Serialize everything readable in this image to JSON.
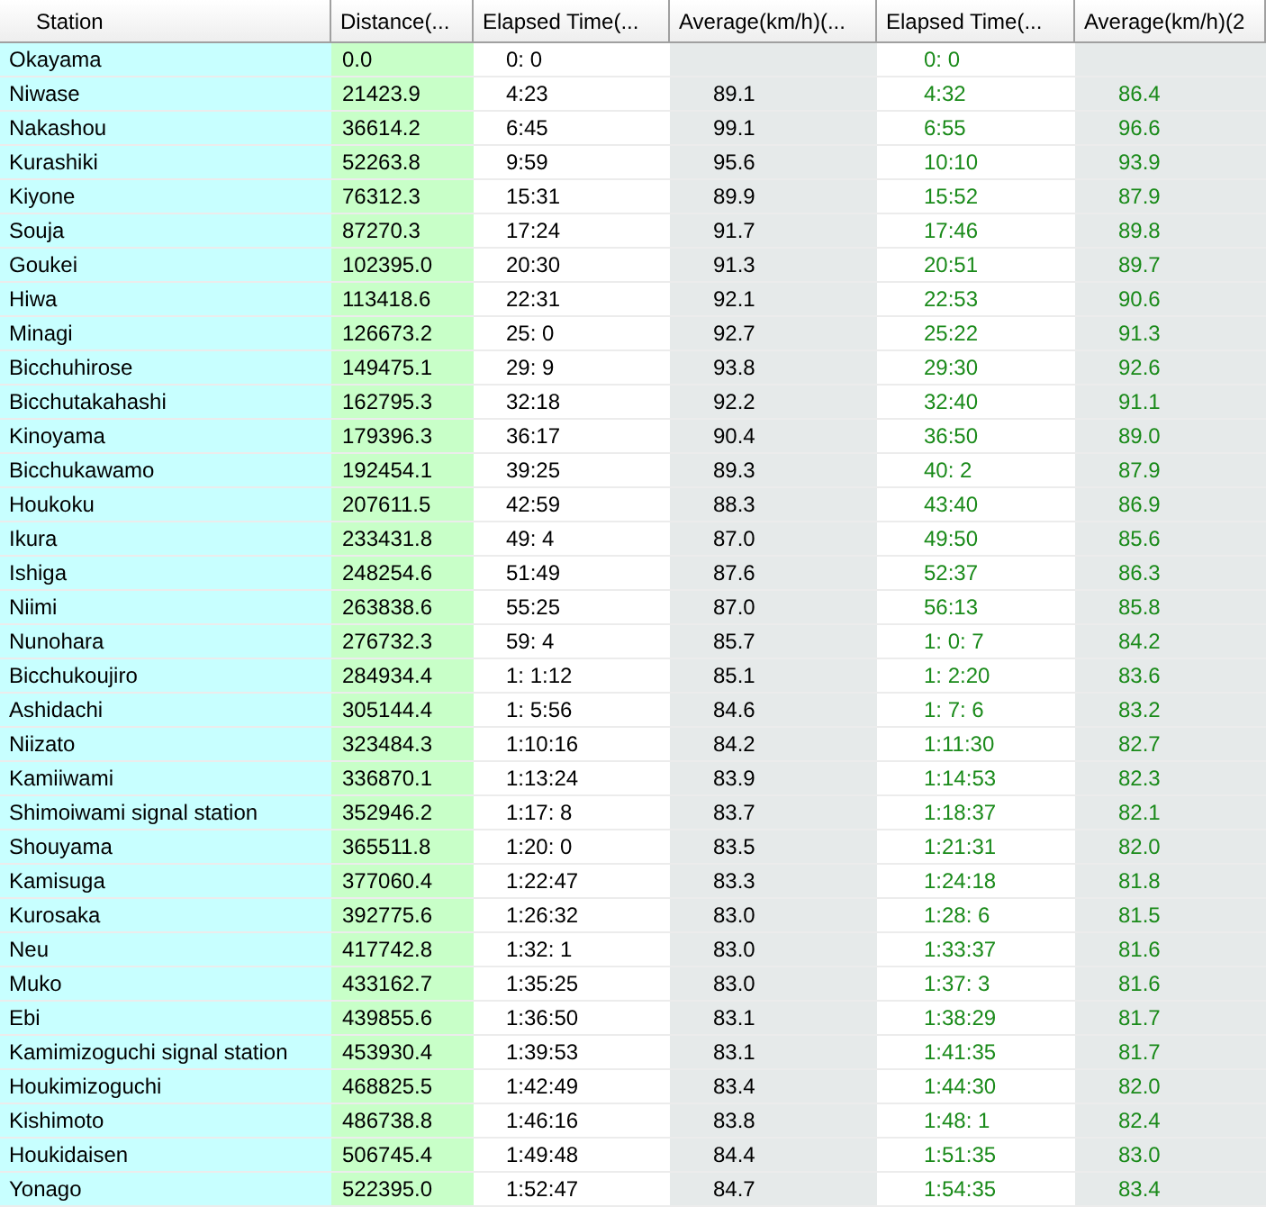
{
  "table": {
    "columns": [
      "Station",
      "Distance(...",
      "Elapsed Time(...",
      "Average(km/h)(...",
      "Elapsed Time(...",
      "Average(km/h)(2"
    ],
    "rows": [
      {
        "station": "Okayama",
        "distance": "0.0",
        "elapsed_1": "0: 0",
        "elapsed_2": "0: 0"
      },
      {
        "station": "Niwase",
        "distance": "21423.9",
        "elapsed_1": "4:23",
        "average_1": "89.1",
        "elapsed_2": "4:32",
        "average_2": "86.4"
      },
      {
        "station": "Nakashou",
        "distance": "36614.2",
        "elapsed_1": "6:45",
        "average_1": "99.1",
        "elapsed_2": "6:55",
        "average_2": "96.6"
      },
      {
        "station": "Kurashiki",
        "distance": "52263.8",
        "elapsed_1": "9:59",
        "average_1": "95.6",
        "elapsed_2": "10:10",
        "average_2": "93.9"
      },
      {
        "station": "Kiyone",
        "distance": "76312.3",
        "elapsed_1": "15:31",
        "average_1": "89.9",
        "elapsed_2": "15:52",
        "average_2": "87.9"
      },
      {
        "station": "Souja",
        "distance": "87270.3",
        "elapsed_1": "17:24",
        "average_1": "91.7",
        "elapsed_2": "17:46",
        "average_2": "89.8"
      },
      {
        "station": "Goukei",
        "distance": "102395.0",
        "elapsed_1": "20:30",
        "average_1": "91.3",
        "elapsed_2": "20:51",
        "average_2": "89.7"
      },
      {
        "station": "Hiwa",
        "distance": "113418.6",
        "elapsed_1": "22:31",
        "average_1": "92.1",
        "elapsed_2": "22:53",
        "average_2": "90.6"
      },
      {
        "station": "Minagi",
        "distance": "126673.2",
        "elapsed_1": "25: 0",
        "average_1": "92.7",
        "elapsed_2": "25:22",
        "average_2": "91.3"
      },
      {
        "station": "Bicchuhirose",
        "distance": "149475.1",
        "elapsed_1": "29: 9",
        "average_1": "93.8",
        "elapsed_2": "29:30",
        "average_2": "92.6"
      },
      {
        "station": "Bicchutakahashi",
        "distance": "162795.3",
        "elapsed_1": "32:18",
        "average_1": "92.2",
        "elapsed_2": "32:40",
        "average_2": "91.1"
      },
      {
        "station": "Kinoyama",
        "distance": "179396.3",
        "elapsed_1": "36:17",
        "average_1": "90.4",
        "elapsed_2": "36:50",
        "average_2": "89.0"
      },
      {
        "station": "Bicchukawamo",
        "distance": "192454.1",
        "elapsed_1": "39:25",
        "average_1": "89.3",
        "elapsed_2": "40: 2",
        "average_2": "87.9"
      },
      {
        "station": "Houkoku",
        "distance": "207611.5",
        "elapsed_1": "42:59",
        "average_1": "88.3",
        "elapsed_2": "43:40",
        "average_2": "86.9"
      },
      {
        "station": "Ikura",
        "distance": "233431.8",
        "elapsed_1": "49: 4",
        "average_1": "87.0",
        "elapsed_2": "49:50",
        "average_2": "85.6"
      },
      {
        "station": "Ishiga",
        "distance": "248254.6",
        "elapsed_1": "51:49",
        "average_1": "87.6",
        "elapsed_2": "52:37",
        "average_2": "86.3"
      },
      {
        "station": "Niimi",
        "distance": "263838.6",
        "elapsed_1": "55:25",
        "average_1": "87.0",
        "elapsed_2": "56:13",
        "average_2": "85.8"
      },
      {
        "station": "Nunohara",
        "distance": "276732.3",
        "elapsed_1": "59: 4",
        "average_1": "85.7",
        "elapsed_2": "1: 0: 7",
        "average_2": "84.2"
      },
      {
        "station": "Bicchukoujiro",
        "distance": "284934.4",
        "elapsed_1": "1: 1:12",
        "average_1": "85.1",
        "elapsed_2": "1: 2:20",
        "average_2": "83.6"
      },
      {
        "station": "Ashidachi",
        "distance": "305144.4",
        "elapsed_1": "1: 5:56",
        "average_1": "84.6",
        "elapsed_2": "1: 7: 6",
        "average_2": "83.2"
      },
      {
        "station": "Niizato",
        "distance": "323484.3",
        "elapsed_1": "1:10:16",
        "average_1": "84.2",
        "elapsed_2": "1:11:30",
        "average_2": "82.7"
      },
      {
        "station": "Kamiiwami",
        "distance": "336870.1",
        "elapsed_1": "1:13:24",
        "average_1": "83.9",
        "elapsed_2": "1:14:53",
        "average_2": "82.3"
      },
      {
        "station": "Shimoiwami signal station",
        "distance": "352946.2",
        "elapsed_1": "1:17: 8",
        "average_1": "83.7",
        "elapsed_2": "1:18:37",
        "average_2": "82.1"
      },
      {
        "station": "Shouyama",
        "distance": "365511.8",
        "elapsed_1": "1:20: 0",
        "average_1": "83.5",
        "elapsed_2": "1:21:31",
        "average_2": "82.0"
      },
      {
        "station": "Kamisuga",
        "distance": "377060.4",
        "elapsed_1": "1:22:47",
        "average_1": "83.3",
        "elapsed_2": "1:24:18",
        "average_2": "81.8"
      },
      {
        "station": "Kurosaka",
        "distance": "392775.6",
        "elapsed_1": "1:26:32",
        "average_1": "83.0",
        "elapsed_2": "1:28: 6",
        "average_2": "81.5"
      },
      {
        "station": "Neu",
        "distance": "417742.8",
        "elapsed_1": "1:32: 1",
        "average_1": "83.0",
        "elapsed_2": "1:33:37",
        "average_2": "81.6"
      },
      {
        "station": "Muko",
        "distance": "433162.7",
        "elapsed_1": "1:35:25",
        "average_1": "83.0",
        "elapsed_2": "1:37: 3",
        "average_2": "81.6"
      },
      {
        "station": "Ebi",
        "distance": "439855.6",
        "elapsed_1": "1:36:50",
        "average_1": "83.1",
        "elapsed_2": "1:38:29",
        "average_2": "81.7"
      },
      {
        "station": "Kamimizoguchi signal station",
        "distance": "453930.4",
        "elapsed_1": "1:39:53",
        "average_1": "83.1",
        "elapsed_2": "1:41:35",
        "average_2": "81.7"
      },
      {
        "station": "Houkimizoguchi",
        "distance": "468825.5",
        "elapsed_1": "1:42:49",
        "average_1": "83.4",
        "elapsed_2": "1:44:30",
        "average_2": "82.0"
      },
      {
        "station": "Kishimoto",
        "distance": "486738.8",
        "elapsed_1": "1:46:16",
        "average_1": "83.8",
        "elapsed_2": "1:48: 1",
        "average_2": "82.4"
      },
      {
        "station": "Houkidaisen",
        "distance": "506745.4",
        "elapsed_1": "1:49:48",
        "average_1": "84.4",
        "elapsed_2": "1:51:35",
        "average_2": "83.0"
      },
      {
        "station": "Yonago",
        "distance": "522395.0",
        "elapsed_1": "1:52:47",
        "average_1": "84.7",
        "elapsed_2": "1:54:35",
        "average_2": "83.4"
      }
    ]
  }
}
